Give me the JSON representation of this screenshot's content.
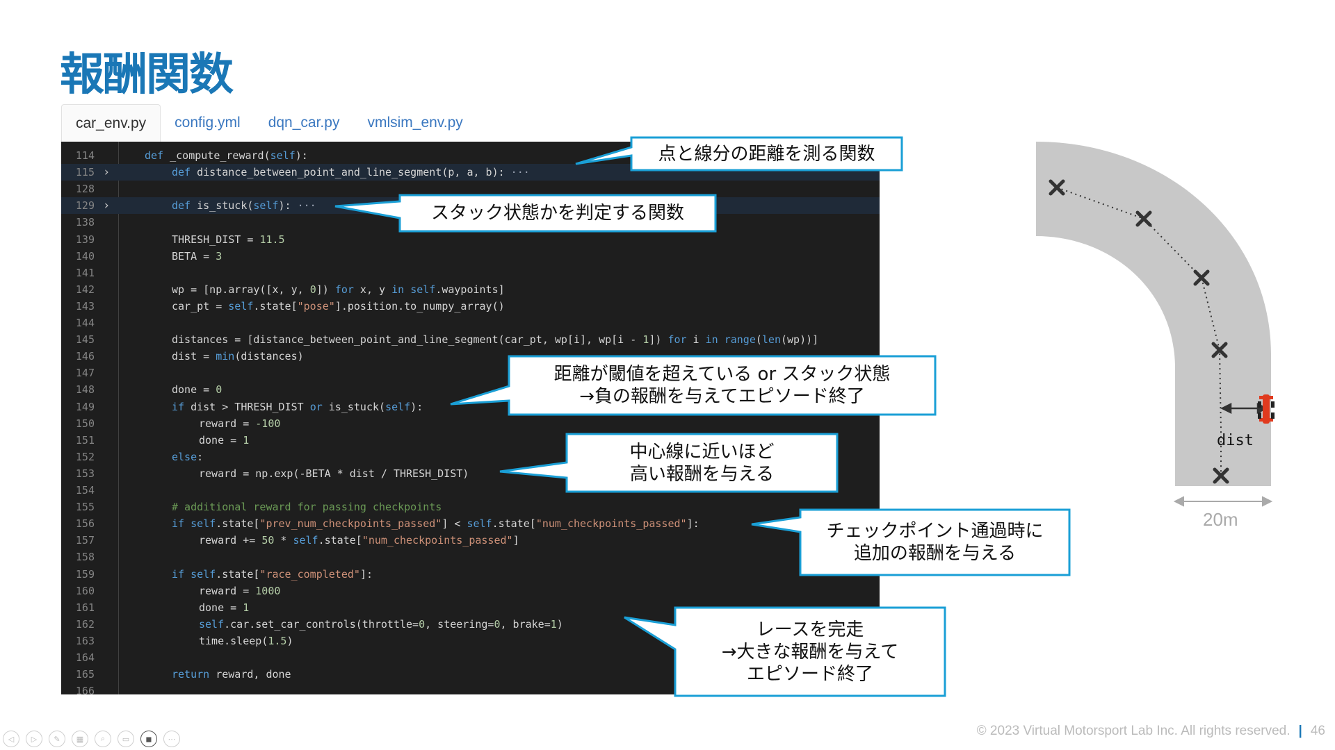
{
  "title": "報酬関数",
  "tabs": [
    {
      "label": "car_env.py",
      "active": true
    },
    {
      "label": "config.yml",
      "active": false
    },
    {
      "label": "dqn_car.py",
      "active": false
    },
    {
      "label": "vmlsim_env.py",
      "active": false
    }
  ],
  "code_lines": [
    {
      "n": "114",
      "html": "<span class=\"kw\">def</span> _compute_reward(<span class=\"kw\">self</span>):",
      "indent": 0
    },
    {
      "n": "115",
      "html": "<span class=\"kw\">def</span> distance_between_point_and_line_segment(p, a, b): <span class=\"dim\">···</span>",
      "indent": 1,
      "fold": true,
      "hl": true
    },
    {
      "n": "128",
      "html": "",
      "indent": 0
    },
    {
      "n": "129",
      "html": "<span class=\"kw\">def</span> is_stuck(<span class=\"kw\">self</span>): <span class=\"dim\">···</span>",
      "indent": 1,
      "fold": true,
      "hl": true
    },
    {
      "n": "138",
      "html": "",
      "indent": 0
    },
    {
      "n": "139",
      "html": "THRESH_DIST = <span class=\"num\">11.5</span>",
      "indent": 1
    },
    {
      "n": "140",
      "html": "BETA = <span class=\"num\">3</span>",
      "indent": 1
    },
    {
      "n": "141",
      "html": "",
      "indent": 0
    },
    {
      "n": "142",
      "html": "wp = [np.array([x, y, <span class=\"num\">0</span>]) <span class=\"kw\">for</span> x, y <span class=\"kw\">in</span> <span class=\"kw\">self</span>.waypoints]",
      "indent": 1
    },
    {
      "n": "143",
      "html": "car_pt = <span class=\"kw\">self</span>.state[<span class=\"str\">\"pose\"</span>].position.to_numpy_array()",
      "indent": 1
    },
    {
      "n": "144",
      "html": "",
      "indent": 0
    },
    {
      "n": "145",
      "html": "distances = [distance_between_point_and_line_segment(car_pt, wp[i], wp[i - <span class=\"num\">1</span>]) <span class=\"kw\">for</span> i <span class=\"kw\">in</span> <span class=\"kw\">range</span>(<span class=\"kw\">len</span>(wp))]",
      "indent": 1
    },
    {
      "n": "146",
      "html": "dist = <span class=\"kw\">min</span>(distances)",
      "indent": 1
    },
    {
      "n": "147",
      "html": "",
      "indent": 0
    },
    {
      "n": "148",
      "html": "done = <span class=\"num\">0</span>",
      "indent": 1
    },
    {
      "n": "149",
      "html": "<span class=\"kw\">if</span> dist &gt; THRESH_DIST <span class=\"kw\">or</span> is_stuck(<span class=\"kw\">self</span>):",
      "indent": 1
    },
    {
      "n": "150",
      "html": "reward = <span class=\"num\">-100</span>",
      "indent": 2
    },
    {
      "n": "151",
      "html": "done = <span class=\"num\">1</span>",
      "indent": 2
    },
    {
      "n": "152",
      "html": "<span class=\"kw\">else</span>:",
      "indent": 1
    },
    {
      "n": "153",
      "html": "reward = np.exp(-BETA * dist / THRESH_DIST)",
      "indent": 2
    },
    {
      "n": "154",
      "html": "",
      "indent": 0
    },
    {
      "n": "155",
      "html": "<span class=\"cm\"># additional reward for passing checkpoints</span>",
      "indent": 1
    },
    {
      "n": "156",
      "html": "<span class=\"kw\">if</span> <span class=\"kw\">self</span>.state[<span class=\"str\">\"prev_num_checkpoints_passed\"</span>] &lt; <span class=\"kw\">self</span>.state[<span class=\"str\">\"num_checkpoints_passed\"</span>]:",
      "indent": 1
    },
    {
      "n": "157",
      "html": "reward += <span class=\"num\">50</span> * <span class=\"kw\">self</span>.state[<span class=\"str\">\"num_checkpoints_passed\"</span>]",
      "indent": 2
    },
    {
      "n": "158",
      "html": "",
      "indent": 0
    },
    {
      "n": "159",
      "html": "<span class=\"kw\">if</span> <span class=\"kw\">self</span>.state[<span class=\"str\">\"race_completed\"</span>]:",
      "indent": 1
    },
    {
      "n": "160",
      "html": "reward = <span class=\"num\">1000</span>",
      "indent": 2
    },
    {
      "n": "161",
      "html": "done = <span class=\"num\">1</span>",
      "indent": 2
    },
    {
      "n": "162",
      "html": "<span class=\"kw\">self</span>.car.set_car_controls(throttle=<span class=\"num\">0</span>, steering=<span class=\"num\">0</span>, brake=<span class=\"num\">1</span>)",
      "indent": 2
    },
    {
      "n": "163",
      "html": "time.sleep(<span class=\"num\">1.5</span>)",
      "indent": 2
    },
    {
      "n": "164",
      "html": "",
      "indent": 0
    },
    {
      "n": "165",
      "html": "<span class=\"kw\">return</span> reward, done",
      "indent": 1
    },
    {
      "n": "166",
      "html": "",
      "indent": 0
    }
  ],
  "callouts": [
    {
      "id": "distance-func",
      "text": "点と線分の距離を測る関数"
    },
    {
      "id": "stuck-func",
      "text": "スタック状態かを判定する関数"
    },
    {
      "id": "threshold-penalty",
      "text": "距離が閾値を超えている or スタック状態\n→負の報酬を与えてエピソード終了"
    },
    {
      "id": "center-reward",
      "text": "中心線に近いほど\n高い報酬を与える"
    },
    {
      "id": "checkpoint-reward",
      "text": "チェックポイント通過時に\n追加の報酬を与える"
    },
    {
      "id": "race-complete",
      "text": "レースを完走\n→大きな報酬を与えて\nエピソード終了"
    }
  ],
  "diagram": {
    "dist_label": "dist",
    "scale_label": "20m",
    "track_color": "#c8c8c8"
  },
  "footer": {
    "copyright": "© 2023 Virtual Motorsport Lab Inc. All rights reserved.",
    "page": "46"
  },
  "colors": {
    "title": "#1a77b6",
    "callout_border": "#1a9fd6",
    "editor_bg": "#1e1e1e"
  }
}
